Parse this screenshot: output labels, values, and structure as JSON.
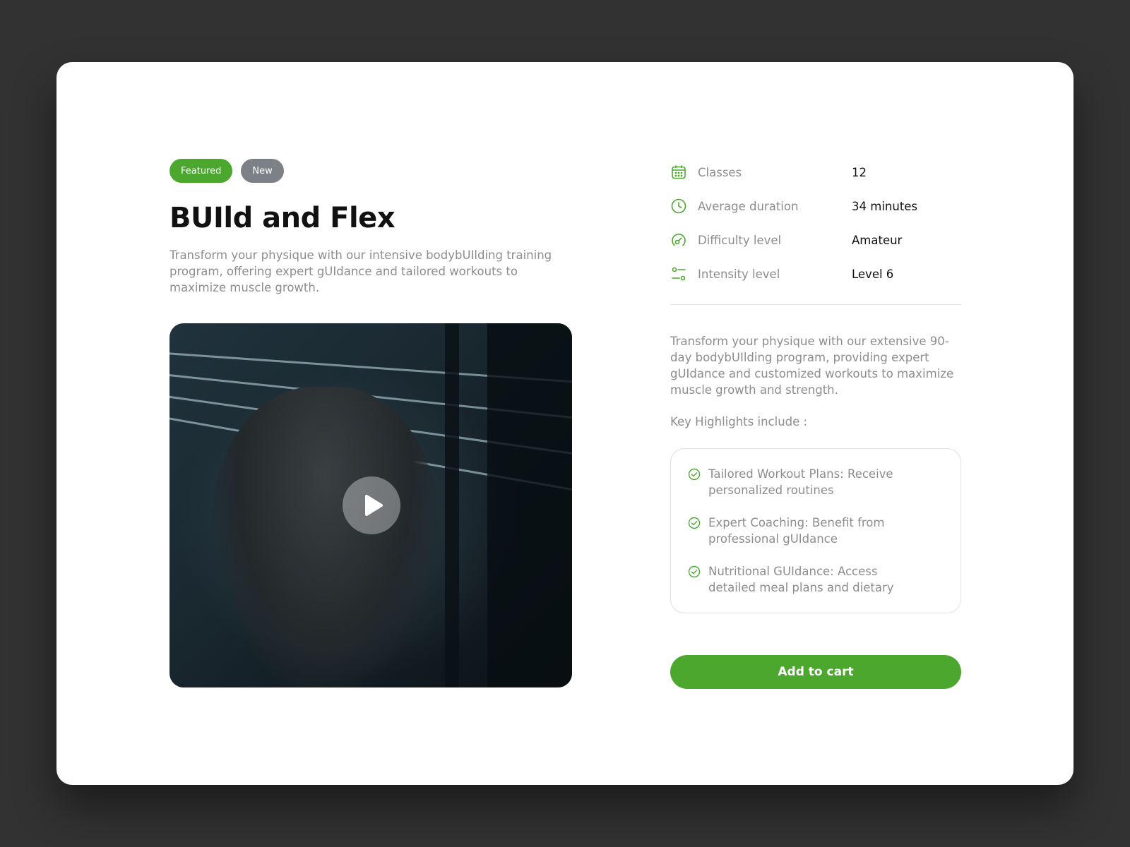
{
  "badges": {
    "featured": "Featured",
    "new": "New"
  },
  "product": {
    "title": "BUIld and Flex",
    "subtitle": "Transform your physique with our intensive bodybUIlding training program, offering expert gUIdance and tailored workouts to maximize muscle growth."
  },
  "media": {
    "play_icon": "play-icon"
  },
  "stats": [
    {
      "icon": "calendar-icon",
      "label": "Classes",
      "value": "12"
    },
    {
      "icon": "clock-icon",
      "label": "Average duration",
      "value": "34 minutes"
    },
    {
      "icon": "gauge-icon",
      "label": "Difficulty level",
      "value": "Amateur"
    },
    {
      "icon": "sliders-icon",
      "label": "Intensity level",
      "value": "Level 6"
    }
  ],
  "description": "Transform your physique with our extensive 90-day bodybUIlding program, providing expert gUIdance and customized workouts to maximize muscle growth and strength.",
  "highlights": {
    "title": "Key Highlights include :",
    "items": [
      "Tailored Workout Plans: Receive personalized routines",
      "Expert Coaching: Benefit from professional gUIdance",
      "Nutritional GUIdance: Access detailed meal plans and dietary"
    ]
  },
  "cart": {
    "label": "Add to cart"
  },
  "colors": {
    "accent": "#4ca72f",
    "badge_new": "#7c8087",
    "background": "#323232"
  }
}
